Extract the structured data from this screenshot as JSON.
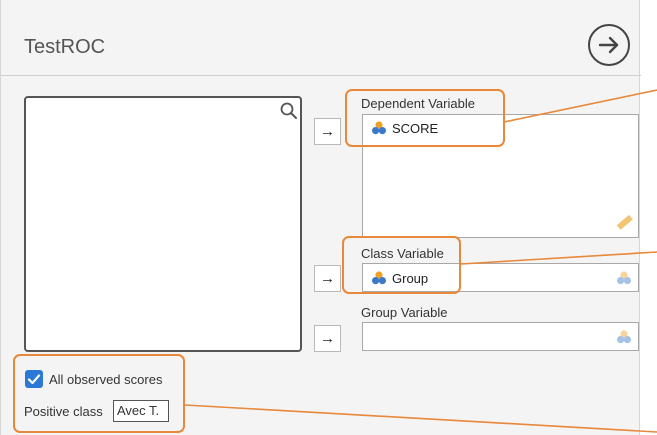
{
  "window": {
    "title": "TestROC"
  },
  "fields": {
    "dependent": {
      "label": "Dependent Variable",
      "value": "SCORE"
    },
    "class": {
      "label": "Class Variable",
      "value": "Group"
    },
    "group": {
      "label": "Group Variable",
      "value": ""
    }
  },
  "options": {
    "all_observed_scores": {
      "label": "All observed scores",
      "checked": true
    },
    "positive_class": {
      "label": "Positive class",
      "value": "Avec T."
    }
  },
  "icons": {
    "go": "arrow-right-circle-icon",
    "search": "search-icon",
    "move": "arrow-right-icon",
    "variable": "nominal-variable-icon",
    "ruler": "ruler-icon"
  },
  "colors": {
    "accent": "#e8883a",
    "checkbox": "#2b78d6"
  },
  "arrow_glyph": "→"
}
